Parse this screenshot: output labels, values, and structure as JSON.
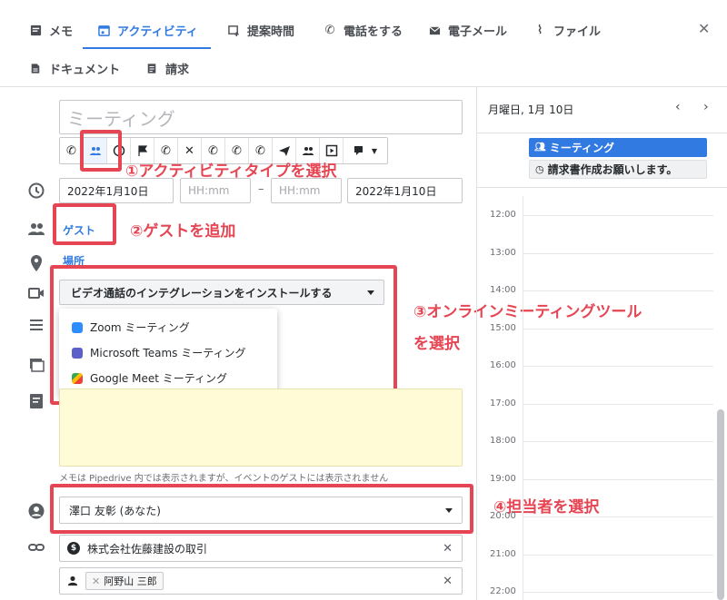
{
  "tabs": [
    {
      "label": "メモ",
      "icon": "note-icon"
    },
    {
      "label": "アクティビティ",
      "icon": "calendar-icon",
      "active": true
    },
    {
      "label": "提案時間",
      "icon": "calendar-plus-icon"
    },
    {
      "label": "電話をする",
      "icon": "phone-icon"
    },
    {
      "label": "電子メール",
      "icon": "mail-icon"
    },
    {
      "label": "ファイル",
      "icon": "paperclip-icon"
    },
    {
      "label": "ドキュメント",
      "icon": "document-icon"
    },
    {
      "label": "請求",
      "icon": "invoice-icon"
    }
  ],
  "form": {
    "title_placeholder": "ミーティング",
    "start_date": "2022年1月10日",
    "start_time_placeholder": "HH:mm",
    "end_time_placeholder": "HH:mm",
    "date_separator": "–",
    "end_date": "2022年1月10日",
    "guest_link": "ゲスト",
    "location_link": "場所",
    "video_dropdown": "ビデオ通話のインテグレーションをインストールする",
    "video_options": [
      "Zoom ミーティング",
      "Microsoft Teams ミーティング",
      "Google Meet ミーティング"
    ],
    "note_hint": "メモは Pipedrive 内では表示されますが、イベントのゲストには表示されません",
    "owner": "澤口 友彰 (あなた)",
    "deal": "株式会社佐藤建設の取引",
    "deal_icon_label": "$",
    "person": "阿野山 三郎"
  },
  "annotations": {
    "a1": "①アクティビティタイプを選択",
    "a2": "②ゲストを追加",
    "a3_line1": "③オンラインミーティングツール",
    "a3_line2": "を選択",
    "a4": "④担当者を選択"
  },
  "calendar": {
    "header": "月曜日, 1月 10日",
    "events": [
      "ミーティング",
      "請求書作成お願いします。"
    ],
    "hours": [
      "12:00",
      "13:00",
      "14:00",
      "15:00",
      "16:00",
      "17:00",
      "18:00",
      "19:00",
      "20:00",
      "21:00",
      "22:00"
    ]
  },
  "colors": {
    "accent": "#317ae2",
    "annotation": "#e64553",
    "note_bg": "#fffbd6"
  }
}
